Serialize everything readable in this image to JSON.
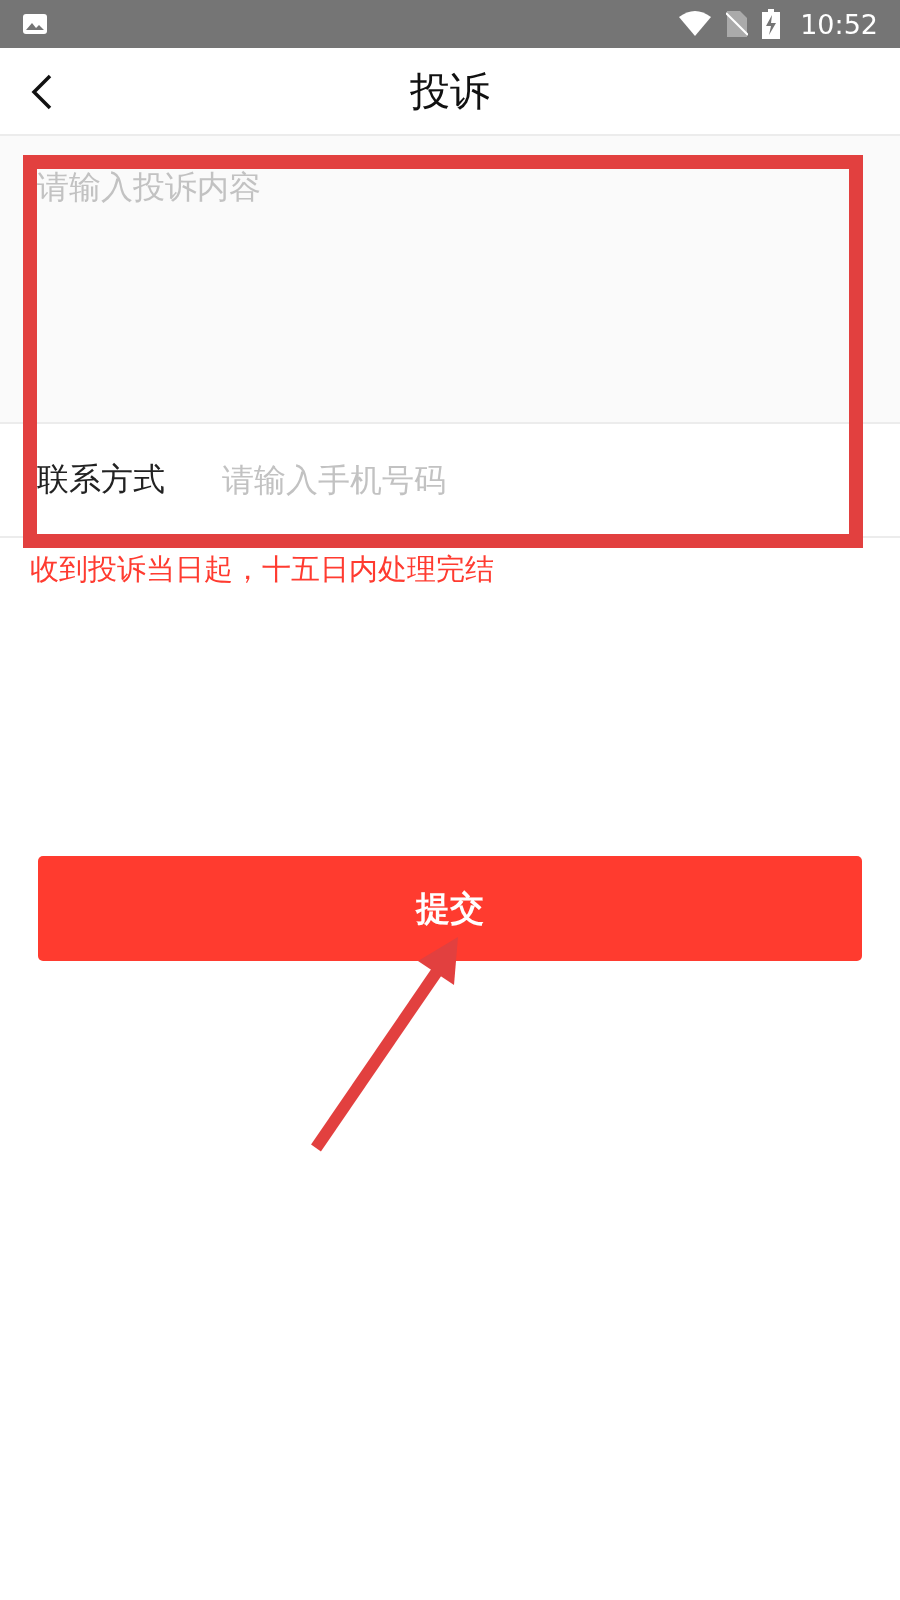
{
  "status_bar": {
    "time": "10:52"
  },
  "header": {
    "title": "投诉"
  },
  "complaint_field": {
    "placeholder": "请输入投诉内容"
  },
  "contact": {
    "label": "联系方式",
    "placeholder": "请输入手机号码"
  },
  "notice": "收到投诉当日起，十五日内处理完结",
  "submit_button": {
    "label": "提交"
  },
  "annotation_box": {
    "color": "#e2403f"
  },
  "annotation_arrow": {
    "color": "#e2403f"
  }
}
